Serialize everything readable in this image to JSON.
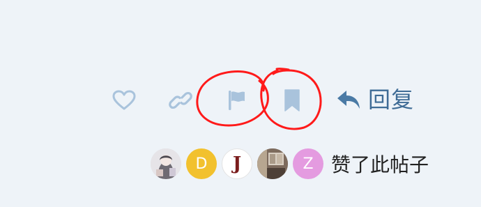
{
  "actions": {
    "like_icon": "heart-icon",
    "link_icon": "link-icon",
    "flag_icon": "flag-icon",
    "bookmark_icon": "bookmark-icon",
    "reply_icon": "reply-arrow-icon",
    "reply_label": "回复"
  },
  "likers": {
    "avatars": [
      {
        "type": "photo",
        "icon": "anime-avatar"
      },
      {
        "type": "letter",
        "letter": "D",
        "color": "#f2c12e"
      },
      {
        "type": "letter",
        "letter": "J",
        "color": "#ffffff"
      },
      {
        "type": "photo",
        "icon": "room-photo-avatar"
      },
      {
        "type": "letter",
        "letter": "Z",
        "color": "#e49be0"
      }
    ],
    "text": "赞了此帖子"
  },
  "colors": {
    "background": "#eef3f8",
    "icon_muted": "#a9c3dc",
    "reply_accent": "#3f6c96",
    "annotation": "#ff1a1a"
  }
}
